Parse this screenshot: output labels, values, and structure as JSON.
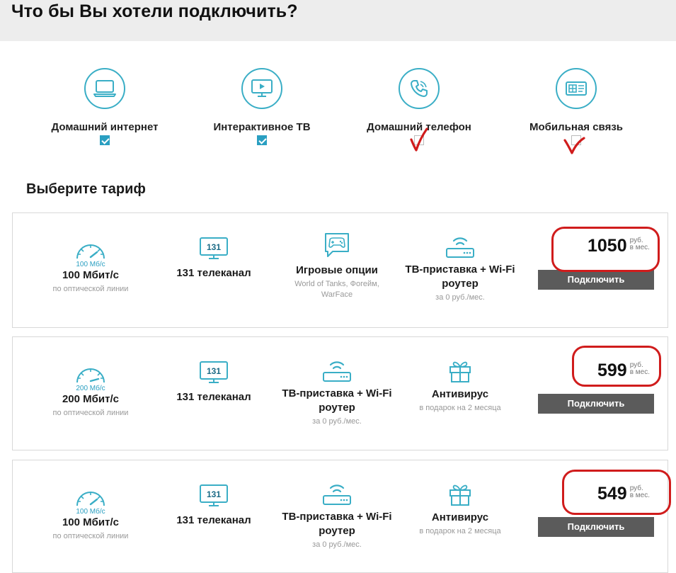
{
  "header": {
    "title": "Что бы Вы хотели подключить?"
  },
  "services": [
    {
      "label": "Домашний интернет",
      "checked": true,
      "icon": "laptop-icon"
    },
    {
      "label": "Интерактивное ТВ",
      "checked": true,
      "icon": "tv-icon"
    },
    {
      "label": "Домашний телефон",
      "checked": false,
      "icon": "phone-icon"
    },
    {
      "label": "Мобильная связь",
      "checked": false,
      "icon": "sim-card-icon"
    }
  ],
  "tariff_section": {
    "title": "Выберите тариф"
  },
  "colors": {
    "accent": "#2a9fc1",
    "button": "#5b5b5b",
    "annotation": "#d01c1c"
  },
  "tariffs": [
    {
      "features": [
        {
          "icon": "speedometer-icon",
          "icon_label": "100 Мб/с",
          "title": "100 Мбит/с",
          "subtitle": "по оптической линии"
        },
        {
          "icon": "tv-channels-icon",
          "icon_label": "131",
          "title": "131 телеканал",
          "subtitle": ""
        },
        {
          "icon": "gamepad-icon",
          "title": "Игровые опции",
          "subtitle": "World of Tanks, Фогейм, WarFace"
        },
        {
          "icon": "router-icon",
          "title": "ТВ-приставка + Wi-Fi роутер",
          "subtitle": "за 0 руб./мес."
        }
      ],
      "price": "1050",
      "currency": "руб.",
      "period": "в мес.",
      "button_label": "Подключить"
    },
    {
      "features": [
        {
          "icon": "speedometer-icon",
          "icon_label": "200 Мб/с",
          "title": "200 Мбит/с",
          "subtitle": "по оптической линии"
        },
        {
          "icon": "tv-channels-icon",
          "icon_label": "131",
          "title": "131 телеканал",
          "subtitle": ""
        },
        {
          "icon": "router-icon",
          "title": "ТВ-приставка + Wi-Fi роутер",
          "subtitle": "за 0 руб./мес."
        },
        {
          "icon": "gift-icon",
          "title": "Антивирус",
          "subtitle": "в подарок на 2 месяца"
        }
      ],
      "price": "599",
      "currency": "руб.",
      "period": "в мес.",
      "button_label": "Подключить"
    },
    {
      "features": [
        {
          "icon": "speedometer-icon",
          "icon_label": "100 Мб/с",
          "title": "100 Мбит/с",
          "subtitle": "по оптической линии"
        },
        {
          "icon": "tv-channels-icon",
          "icon_label": "131",
          "title": "131 телеканал",
          "subtitle": ""
        },
        {
          "icon": "router-icon",
          "title": "ТВ-приставка + Wi-Fi роутер",
          "subtitle": "за 0 руб./мес."
        },
        {
          "icon": "gift-icon",
          "title": "Антивирус",
          "subtitle": "в подарок на 2 месяца"
        }
      ],
      "price": "549",
      "currency": "руб.",
      "period": "в мес.",
      "button_label": "Подключить"
    }
  ]
}
